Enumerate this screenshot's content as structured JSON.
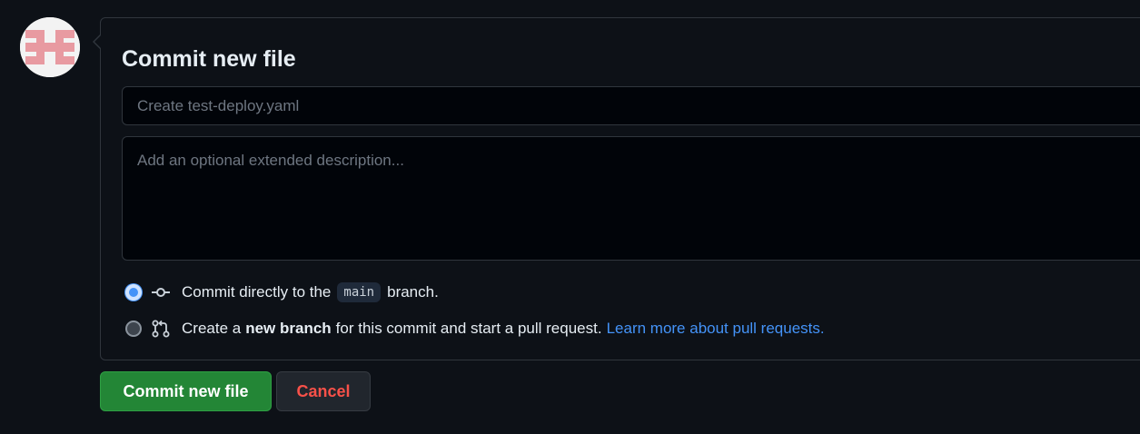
{
  "avatar": {
    "icon": "identicon-avatar",
    "color": "#e89aa1"
  },
  "form": {
    "title": "Commit new file",
    "summary_placeholder": "Create test-deploy.yaml",
    "summary_value": "",
    "description_placeholder": "Add an optional extended description...",
    "description_value": ""
  },
  "options": {
    "direct": {
      "selected": true,
      "icon": "git-commit-icon",
      "text_before": "Commit directly to the",
      "branch": "main",
      "text_after": "branch."
    },
    "new_branch": {
      "selected": false,
      "icon": "git-pull-request-icon",
      "text_before": "Create a",
      "bold": "new branch",
      "text_after": "for this commit and start a pull request.",
      "link": "Learn more about pull requests."
    }
  },
  "buttons": {
    "commit_label": "Commit new file",
    "cancel_label": "Cancel"
  },
  "colors": {
    "accent": "#4493f8",
    "primary_button": "#238636",
    "danger_text": "#f85149",
    "background": "#0d1117"
  }
}
